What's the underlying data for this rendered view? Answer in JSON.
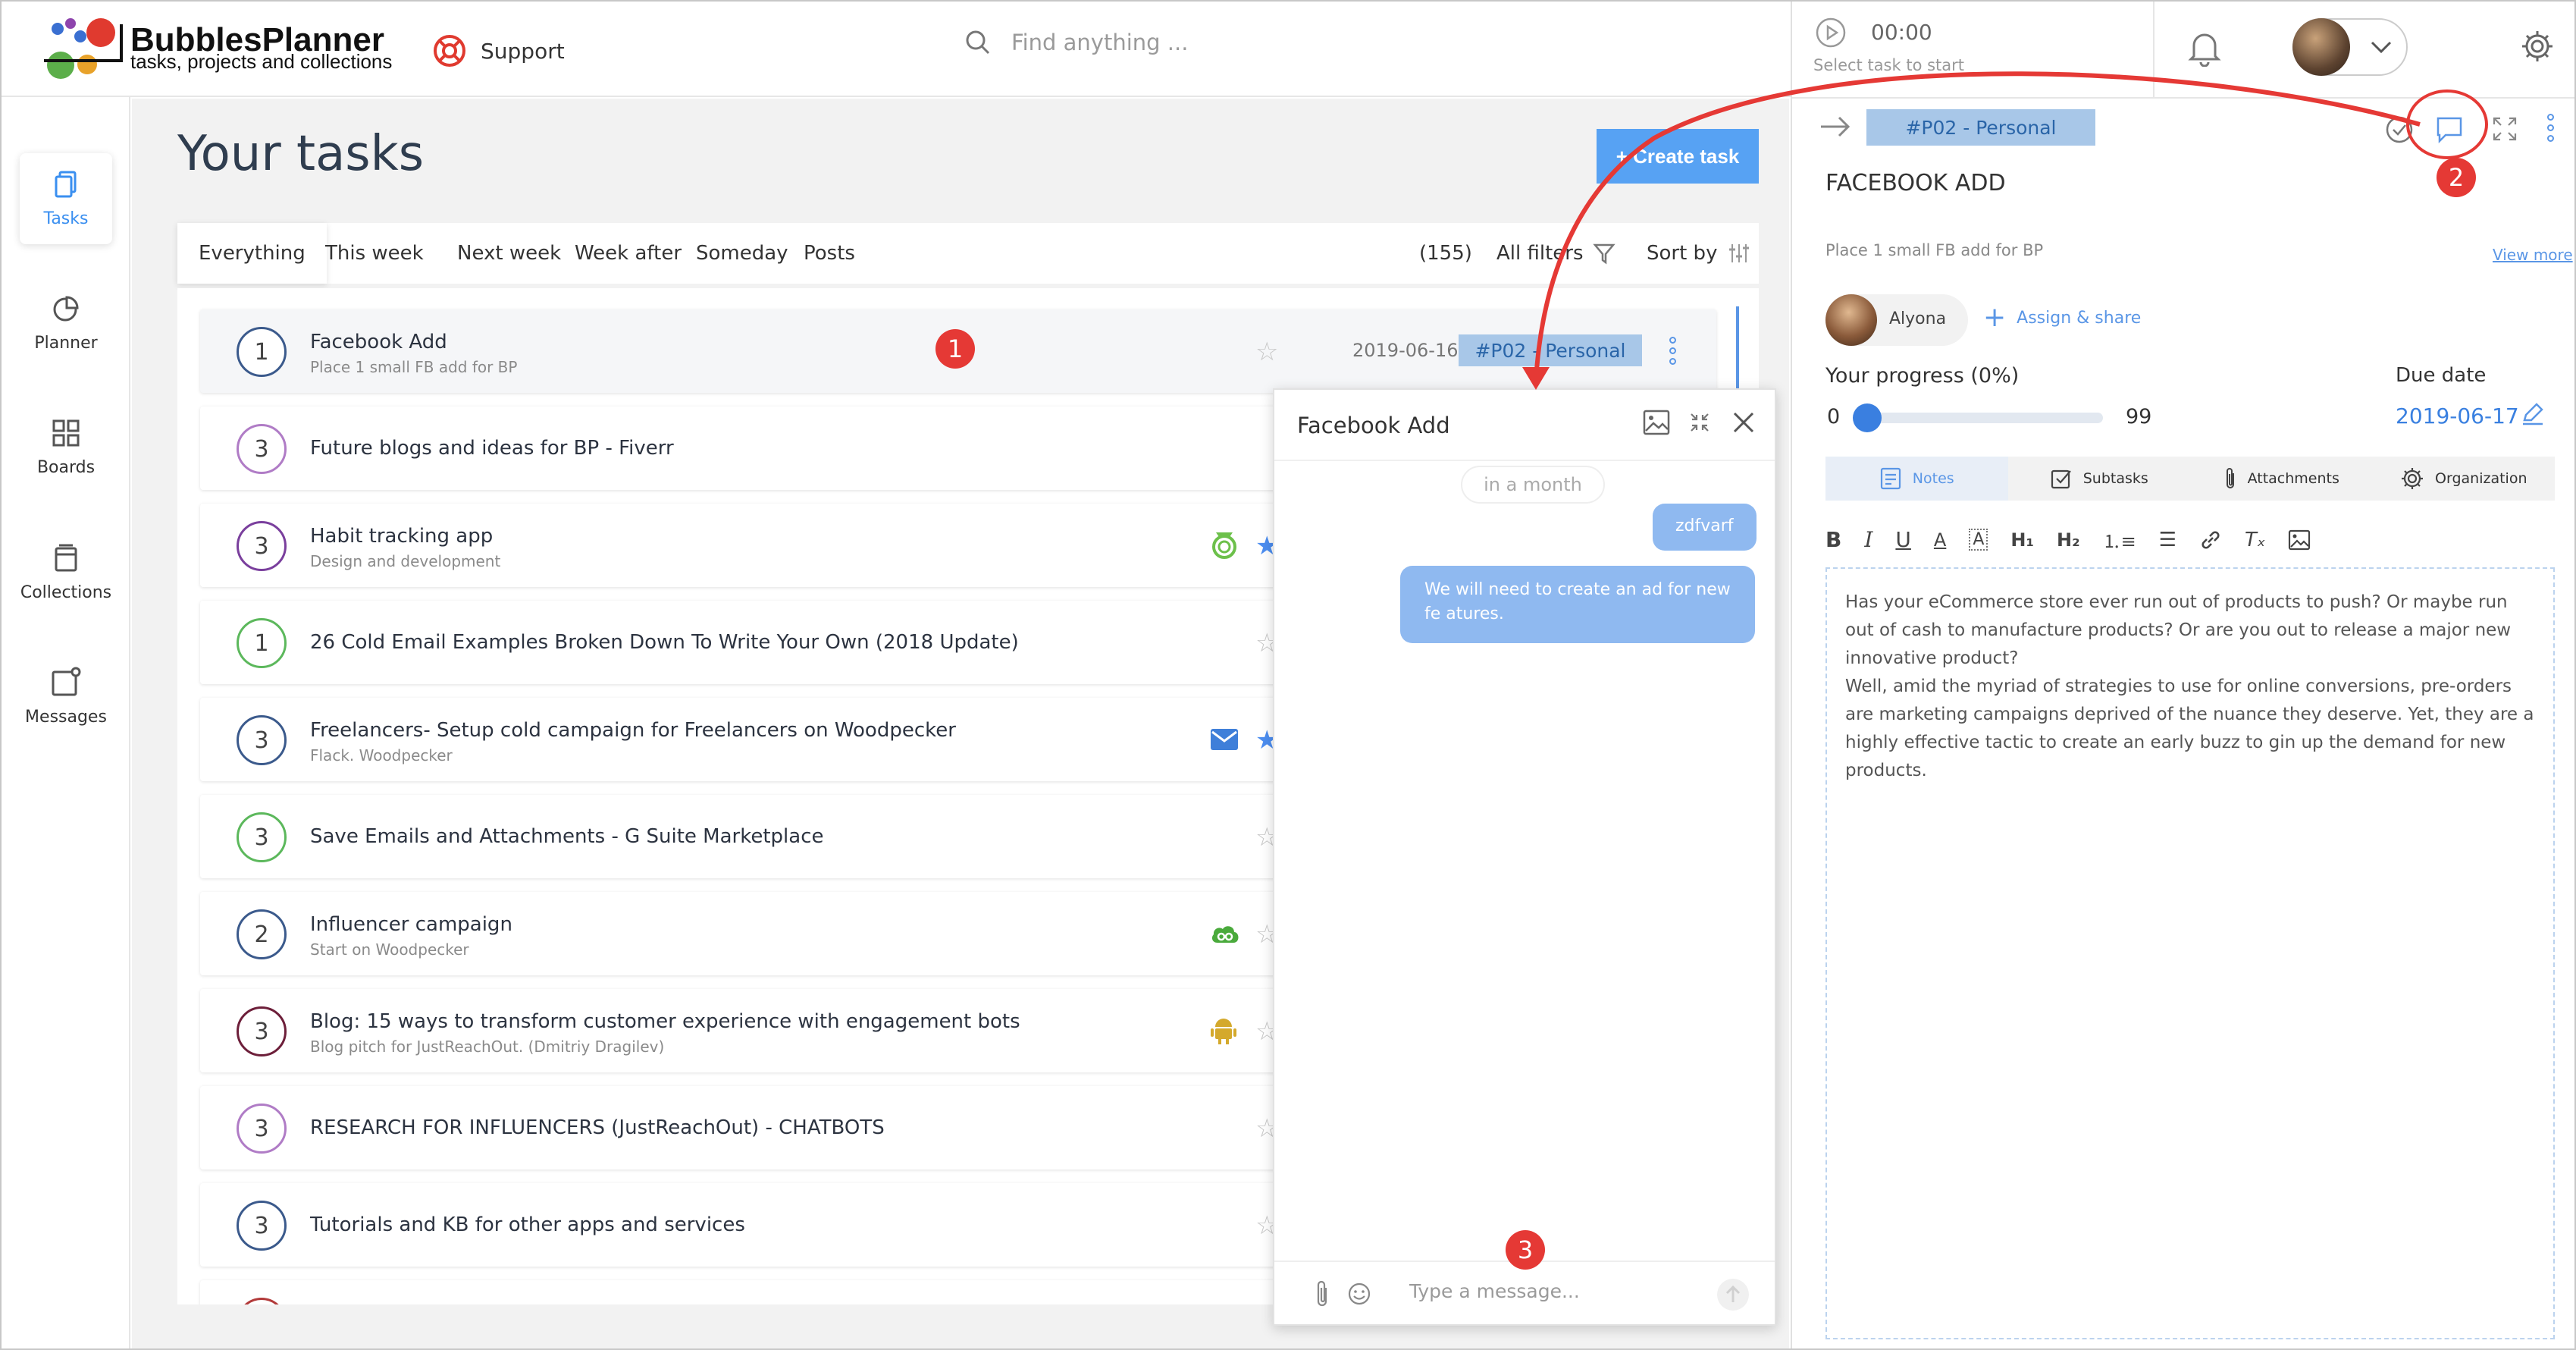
{
  "header": {
    "brand_name": "BubblesPlanner",
    "brand_tagline": "tasks, projects and collections",
    "support_label": "Support",
    "search_placeholder": "Find anything ...",
    "timer": "00:00",
    "timer_hint": "Select task to start"
  },
  "sidebar": {
    "items": [
      {
        "label": "Tasks",
        "icon": "document-icon",
        "active": true
      },
      {
        "label": "Planner",
        "icon": "pie-chart-icon"
      },
      {
        "label": "Boards",
        "icon": "grid-icon"
      },
      {
        "label": "Collections",
        "icon": "stack-icon"
      },
      {
        "label": "Messages",
        "icon": "message-icon"
      }
    ]
  },
  "main": {
    "title": "Your tasks",
    "create_label": "+ Create task",
    "tabs": [
      "Everything",
      "This week",
      "Next week",
      "Week after",
      "Someday",
      "Posts"
    ],
    "count": "(155)",
    "all_filters": "All filters",
    "sort_by": "Sort by"
  },
  "tasks": [
    {
      "num": "1",
      "title": "Facebook Add",
      "subtitle": "Place 1 small FB add for BP",
      "date": "2019-06-16",
      "tag": "#P02 - Personal",
      "color": "#3b5a8c"
    },
    {
      "num": "3",
      "title": "Future blogs and ideas for BP - Fiverr",
      "subtitle": "",
      "color": "#b07cc6"
    },
    {
      "num": "3",
      "title": "Habit tracking app",
      "subtitle": "Design and development",
      "color": "#7a3f9d"
    },
    {
      "num": "1",
      "title": "26 Cold Email Examples Broken Down To Write Your Own (2018 Update)",
      "subtitle": "",
      "color": "#5cb85c"
    },
    {
      "num": "3",
      "title": "Freelancers- Setup cold campaign for Freelancers on Woodpecker",
      "subtitle": "Flack. Woodpecker",
      "color": "#3b5a8c"
    },
    {
      "num": "3",
      "title": "Save Emails and Attachments - G Suite Marketplace",
      "subtitle": "",
      "color": "#5cb85c"
    },
    {
      "num": "2",
      "title": "Influencer campaign",
      "subtitle": "Start on Woodpecker",
      "color": "#3b5a8c"
    },
    {
      "num": "3",
      "title": "Blog: 15 ways to transform customer experience with engagement bots",
      "subtitle": "Blog pitch for JustReachOut. (Dmitriy Dragilev)",
      "color": "#6d1f3a"
    },
    {
      "num": "3",
      "title": "RESEARCH FOR INFLUENCERS (JustReachOut) - CHATBOTS",
      "subtitle": "",
      "color": "#b07cc6"
    },
    {
      "num": "3",
      "title": "Tutorials and KB for other apps and services",
      "subtitle": "",
      "color": "#3b5a8c"
    }
  ],
  "chat": {
    "title": "Facebook Add",
    "time_label": "in a month",
    "messages": [
      "zdfvarf",
      "We will need to create an ad for new fe atures."
    ],
    "input_placeholder": "Type a message..."
  },
  "panel": {
    "tag": "#P02 - Personal",
    "title": "FACEBOOK ADD",
    "description": "Place 1 small FB add for BP",
    "view_more": "View more",
    "assignee": "Alyona",
    "assign_share": "Assign & share",
    "progress_label": "Your progress",
    "progress_pct": "(0%)",
    "progress_min": "0",
    "progress_max": "99",
    "progress_value": 0,
    "due_label": "Due date",
    "due_date": "2019-06-17",
    "tabs": [
      "Notes",
      "Subtasks",
      "Attachments",
      "Organization"
    ],
    "notes_p1": "Has your eCommerce store ever run out of products to push? Or maybe run out of cash to manufacture products? Or are you out to release a major new innovative product?",
    "notes_p2": "Well, amid the myriad of strategies to use for online conversions, pre-orders are marketing campaigns deprived of the nuance they deserve. Yet, they are a highly effective tactic to create an early buzz to gin up the demand for new products."
  },
  "annotations": [
    "1",
    "2",
    "3"
  ],
  "colors": {
    "accent": "#57a2f3",
    "tag_bg": "#a8c7e8",
    "annotation": "#e53935"
  }
}
